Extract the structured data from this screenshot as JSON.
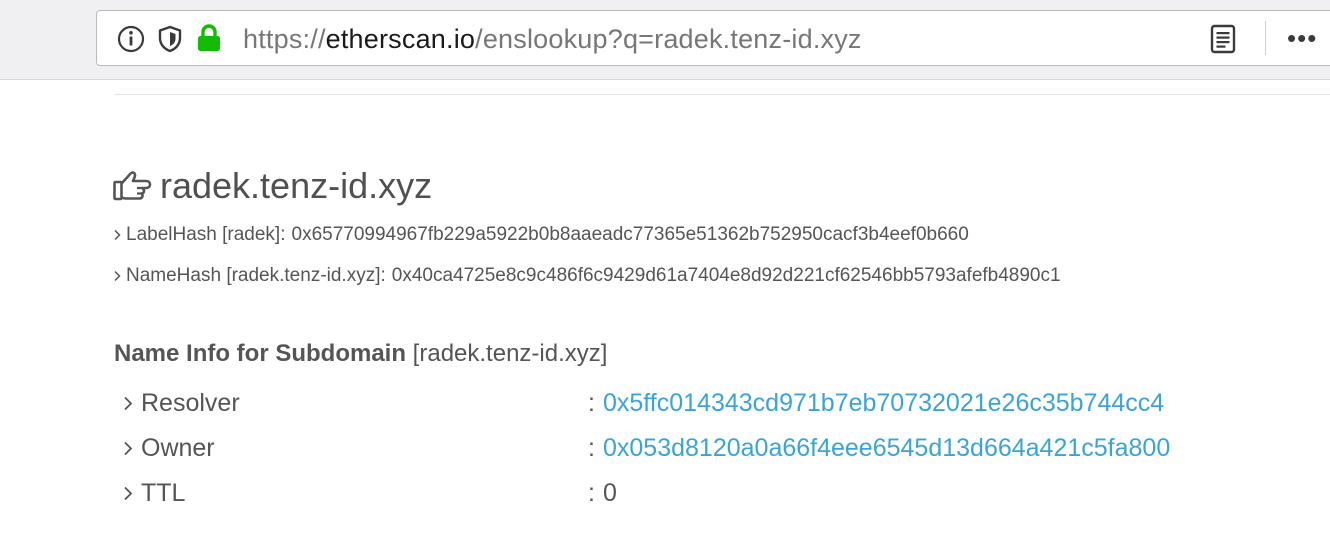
{
  "browser": {
    "url_scheme": "https://",
    "url_host": "etherscan.io",
    "url_path": "/enslookup?q=radek.tenz-id.xyz"
  },
  "page": {
    "title": "radek.tenz-id.xyz",
    "label_hash": {
      "label": "LabelHash [radek]:",
      "value": "0x65770994967fb229a5922b0b8aaeadc77365e51362b752950cacf3b4eef0b660"
    },
    "name_hash": {
      "label": "NameHash [radek.tenz-id.xyz]:",
      "value": "0x40ca4725e8c9c486f6c9429d61a7404e8d92d221cf62546bb5793afefb4890c1"
    },
    "section": {
      "heading_bold": "Name Info for Subdomain",
      "heading_rest": " [radek.tenz-id.xyz]"
    },
    "info_rows": [
      {
        "label": "Resolver",
        "colon": ":",
        "value": "0x5ffc014343cd971b7eb70732021e26c35b744cc4"
      },
      {
        "label": "Owner",
        "colon": ":",
        "value": "0x053d8120a0a66f4eee6545d13d664a421c5fa800"
      },
      {
        "label": "TTL",
        "colon": ":",
        "value": "0"
      }
    ]
  },
  "icons": {
    "info": "info-icon",
    "tracking": "shield-icon",
    "secure": "lock-icon",
    "reader": "reader-view-icon",
    "menu": "more-actions-icon",
    "title": "hand-pointing-right-icon",
    "row": "chevron-right-icon"
  },
  "colors": {
    "link": "#3aa4d8",
    "lock": "#12bc00",
    "text": "#555555"
  }
}
